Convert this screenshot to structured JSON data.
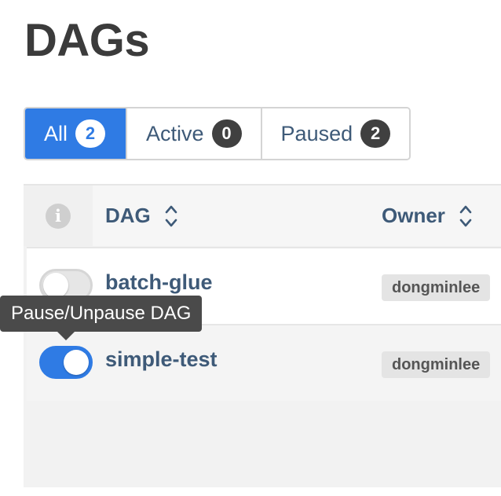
{
  "page": {
    "title": "DAGs"
  },
  "filters": [
    {
      "label": "All",
      "count": "2",
      "active": true
    },
    {
      "label": "Active",
      "count": "0",
      "active": false
    },
    {
      "label": "Paused",
      "count": "2",
      "active": false
    }
  ],
  "table": {
    "columns": {
      "info_icon": "info-icon",
      "dag": "DAG",
      "owner": "Owner"
    },
    "rows": [
      {
        "dag_id": "batch-glue",
        "owner": "dongminlee",
        "toggle": "off"
      },
      {
        "dag_id": "simple-test",
        "owner": "dongminlee",
        "toggle": "on"
      }
    ]
  },
  "tooltip": {
    "text": "Pause/Unpause DAG"
  },
  "colors": {
    "primary": "#2f7be4",
    "link": "#3e5a78",
    "badge_dark": "#404040",
    "tooltip_bg": "#4a4a4a"
  }
}
